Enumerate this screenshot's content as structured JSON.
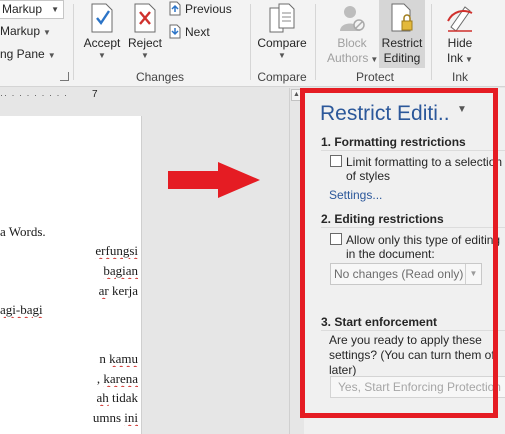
{
  "ribbon": {
    "tracking": {
      "markup_dropdown": "Markup",
      "show_markup": "Markup",
      "reviewing_pane": "ng Pane"
    },
    "changes": {
      "accept": "Accept",
      "reject": "Reject",
      "previous": "Previous",
      "next": "Next",
      "label": "Changes"
    },
    "compare": {
      "button": "Compare",
      "label": "Compare"
    },
    "protect": {
      "block_authors_1": "Block",
      "block_authors_2": "Authors",
      "restrict_editing_1": "Restrict",
      "restrict_editing_2": "Editing",
      "label": "Protect"
    },
    "ink": {
      "hide_ink_1": "Hide",
      "hide_ink_2": "Ink",
      "label": "Ink"
    }
  },
  "ruler": {
    "marks": "·· · · · · · · · ·",
    "number": "7"
  },
  "document": {
    "lines": [
      {
        "pre": "a Words.",
        "sq": "",
        "post": ""
      },
      {
        "pre": "",
        "sq": "erfungsi",
        "post": ""
      },
      {
        "pre": "",
        "sq": "bagian",
        "post": ""
      },
      {
        "pre": "",
        "sq": "ar",
        "post": "  kerja"
      },
      {
        "pre": "",
        "sq": "agi-bagi",
        "post": ""
      },
      {
        "pre": "n  ",
        "sq": "kamu",
        "post": ""
      },
      {
        "pre": ", ",
        "sq": "karena",
        "post": ""
      },
      {
        "pre": "",
        "sq": "ah",
        "post": " tidak"
      },
      {
        "pre": "umns ",
        "sq": "ini",
        "post": ""
      }
    ]
  },
  "pane": {
    "title": "Restrict Editi..",
    "formatting": {
      "heading": "1. Formatting restrictions",
      "checkbox_line1": "Limit formatting to a selection",
      "checkbox_line2": "of styles",
      "settings_link": "Settings..."
    },
    "editing": {
      "heading": "2. Editing restrictions",
      "checkbox_line1": "Allow only this type of editing",
      "checkbox_line2": "in the document:",
      "mode": "No changes (Read only)"
    },
    "enforcement": {
      "heading": "3. Start enforcement",
      "question_1": "Are you ready to apply these",
      "question_2": "settings? (You can turn them off",
      "question_3": "later)",
      "button": "Yes, Start Enforcing Protection"
    }
  },
  "colors": {
    "accent": "#2b579a",
    "highlight": "#e51c23",
    "arrow": "#e51c23"
  }
}
